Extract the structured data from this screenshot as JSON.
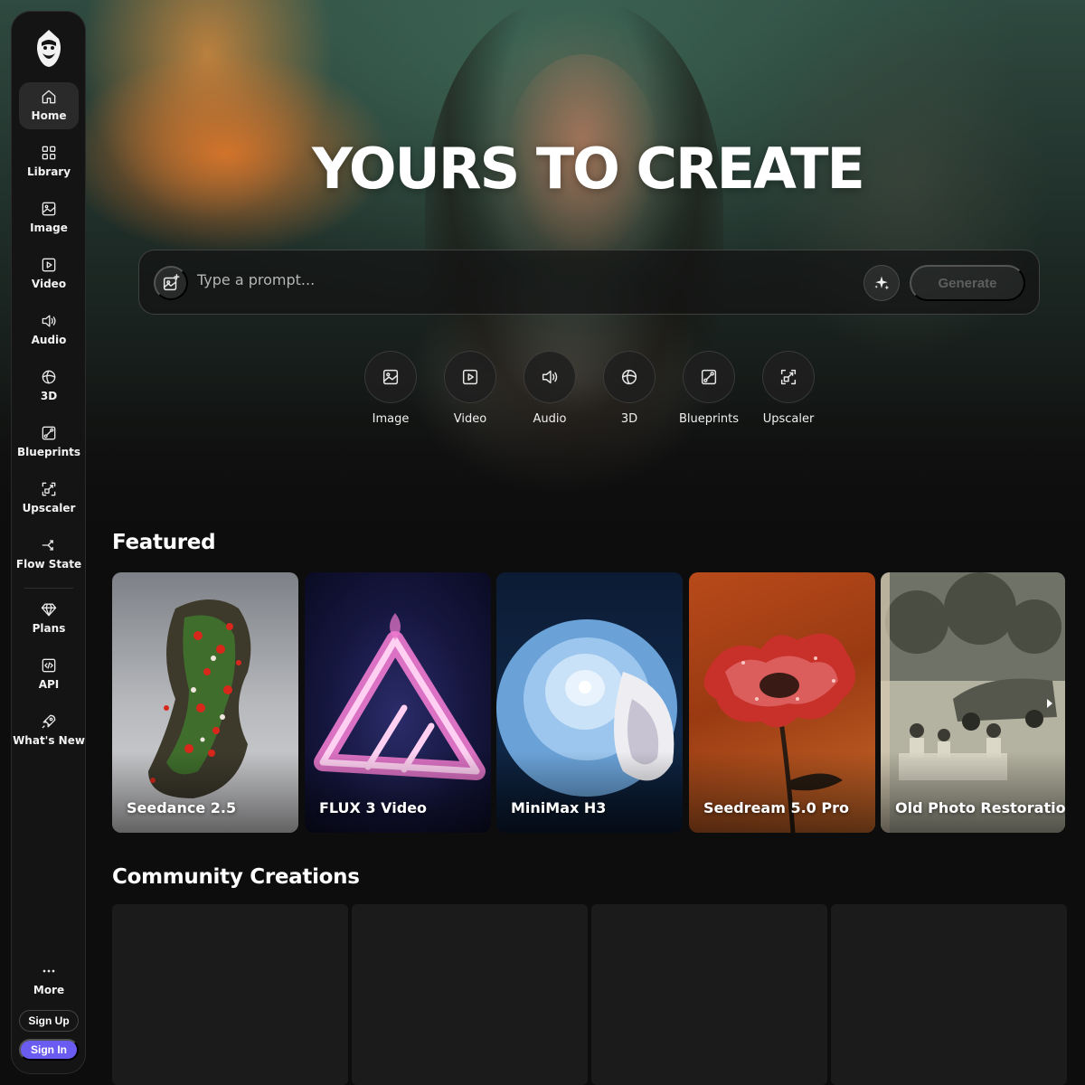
{
  "sidebar": {
    "items": [
      {
        "label": "Home",
        "icon": "home-icon"
      },
      {
        "label": "Library",
        "icon": "library-icon"
      },
      {
        "label": "Image",
        "icon": "image-icon"
      },
      {
        "label": "Video",
        "icon": "video-icon"
      },
      {
        "label": "Audio",
        "icon": "audio-icon"
      },
      {
        "label": "3D",
        "icon": "globe-icon"
      },
      {
        "label": "Blueprints",
        "icon": "blueprints-icon"
      },
      {
        "label": "Upscaler",
        "icon": "upscaler-icon"
      },
      {
        "label": "Flow State",
        "icon": "flow-state-icon"
      },
      {
        "label": "Plans",
        "icon": "diamond-icon"
      },
      {
        "label": "API",
        "icon": "code-icon"
      },
      {
        "label": "What's New",
        "icon": "rocket-icon"
      }
    ],
    "more_label": "More",
    "signup_label": "Sign Up",
    "signin_label": "Sign In"
  },
  "hero": {
    "title": "YOURS TO CREATE",
    "prompt_placeholder": "Type a prompt...",
    "generate_label": "Generate"
  },
  "quick_tools": [
    {
      "label": "Image",
      "icon": "image-icon"
    },
    {
      "label": "Video",
      "icon": "video-icon"
    },
    {
      "label": "Audio",
      "icon": "audio-icon"
    },
    {
      "label": "3D",
      "icon": "globe-icon"
    },
    {
      "label": "Blueprints",
      "icon": "blueprints-icon"
    },
    {
      "label": "Upscaler",
      "icon": "upscaler-icon"
    }
  ],
  "featured": {
    "title": "Featured",
    "cards": [
      {
        "label": "Seedance 2.5"
      },
      {
        "label": "FLUX 3 Video"
      },
      {
        "label": "MiniMax H3"
      },
      {
        "label": "Seedream 5.0 Pro"
      },
      {
        "label": "Old Photo Restoration"
      }
    ]
  },
  "community": {
    "title": "Community Creations"
  },
  "colors": {
    "accent": "#6a5cf0",
    "background": "#0d0d0d",
    "sidebar": "#141414"
  }
}
